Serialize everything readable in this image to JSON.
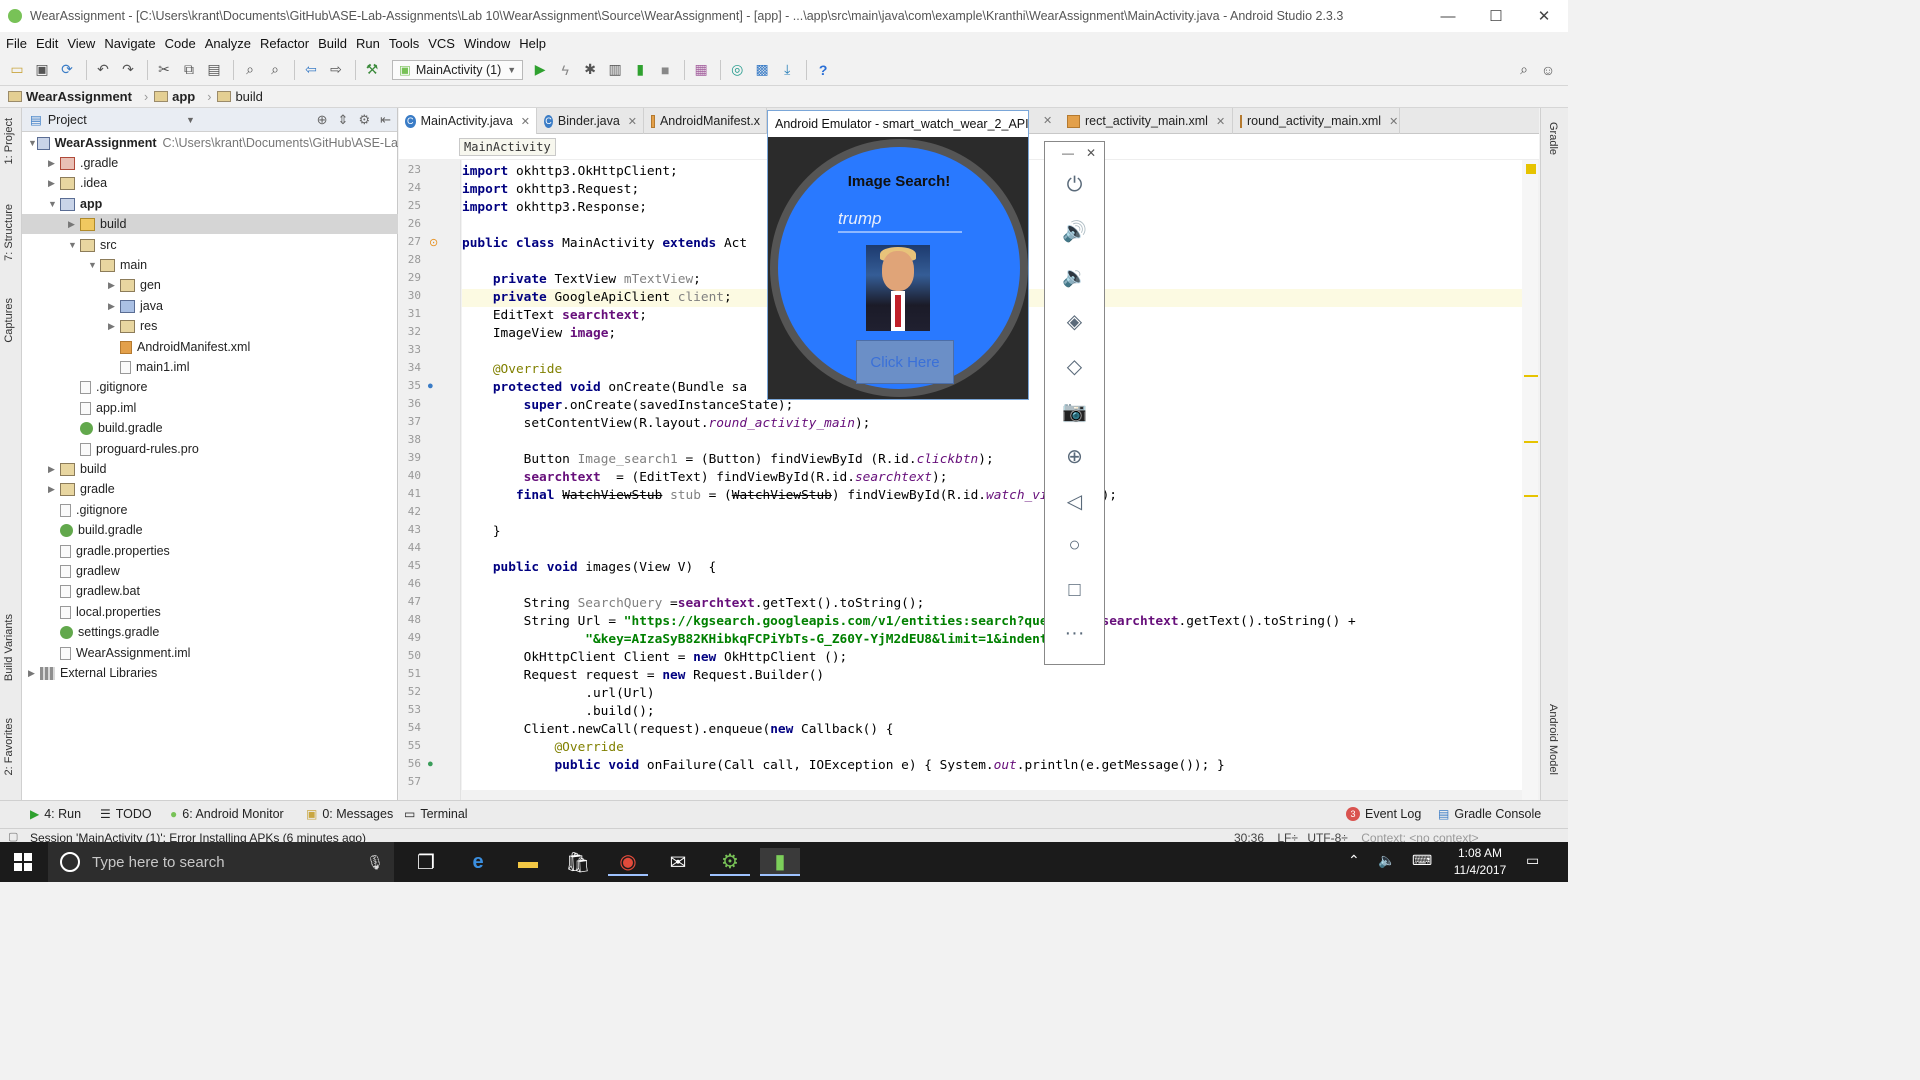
{
  "window": {
    "title": "WearAssignment - [C:\\Users\\krant\\Documents\\GitHub\\ASE-Lab-Assignments\\Lab 10\\WearAssignment\\Source\\WearAssignment] - [app] - ...\\app\\src\\main\\java\\com\\example\\Kranthi\\WearAssignment\\MainActivity.java - Android Studio 2.3.3",
    "minimize": "—",
    "maximize": "☐",
    "close": "✕"
  },
  "menu": [
    "File",
    "Edit",
    "View",
    "Navigate",
    "Code",
    "Analyze",
    "Refactor",
    "Build",
    "Run",
    "Tools",
    "VCS",
    "Window",
    "Help"
  ],
  "toolbar": {
    "run_config": "MainActivity (1)"
  },
  "nav": {
    "project": "WearAssignment",
    "module": "app",
    "folder": "build"
  },
  "side_tabs": {
    "project": "1: Project",
    "structure": "7: Structure",
    "captures": "Captures",
    "build_variants": "Build Variants",
    "favorites": "2: Favorites",
    "gradle": "Gradle",
    "android_model": "Android Model"
  },
  "project_panel": {
    "view_label": "Project",
    "tree": [
      {
        "label": "WearAssignment",
        "hint": "C:\\Users\\krant\\Documents\\GitHub\\ASE-La",
        "bold": true
      },
      {
        "label": ".gradle"
      },
      {
        "label": ".idea"
      },
      {
        "label": "app",
        "bold": true
      },
      {
        "label": "build"
      },
      {
        "label": "src"
      },
      {
        "label": "main"
      },
      {
        "label": "gen"
      },
      {
        "label": "java"
      },
      {
        "label": "res"
      },
      {
        "label": "AndroidManifest.xml"
      },
      {
        "label": "main1.iml"
      },
      {
        "label": ".gitignore"
      },
      {
        "label": "app.iml"
      },
      {
        "label": "build.gradle"
      },
      {
        "label": "proguard-rules.pro"
      },
      {
        "label": "build"
      },
      {
        "label": "gradle"
      },
      {
        "label": ".gitignore"
      },
      {
        "label": "build.gradle"
      },
      {
        "label": "gradle.properties"
      },
      {
        "label": "gradlew"
      },
      {
        "label": "gradlew.bat"
      },
      {
        "label": "local.properties"
      },
      {
        "label": "settings.gradle"
      },
      {
        "label": "WearAssignment.iml"
      },
      {
        "label": "External Libraries"
      }
    ]
  },
  "editor": {
    "tabs": [
      "MainActivity.java",
      "Binder.java",
      "AndroidManifest.x",
      "rect_activity_main.xml",
      "round_activity_main.xml"
    ],
    "breadcrumb_class": "MainActivity",
    "line_numbers": [
      "23",
      "24",
      "25",
      "26",
      "27",
      "28",
      "29",
      "30",
      "31",
      "32",
      "33",
      "34",
      "35",
      "36",
      "37",
      "38",
      "39",
      "40",
      "41",
      "42",
      "43",
      "44",
      "45",
      "46",
      "47",
      "48",
      "49",
      "50",
      "51",
      "52",
      "53",
      "54",
      "55",
      "56",
      "57"
    ]
  },
  "emulator": {
    "title": "Android Emulator - smart_watch_wear_2_API_...",
    "app_title": "Image Search!",
    "query": "trump",
    "button": "Click Here",
    "controls": [
      "power-icon",
      "volume-up-icon",
      "volume-down-icon",
      "rotate-left-icon",
      "rotate-right-icon",
      "camera-icon",
      "zoom-icon",
      "back-icon",
      "home-icon",
      "overview-icon",
      "more-icon"
    ]
  },
  "bottom_tools": {
    "run": "4: Run",
    "todo": "TODO",
    "monitor": "6: Android Monitor",
    "messages": "0: Messages",
    "terminal": "Terminal",
    "event_log": "Event Log",
    "event_count": "3",
    "gradle_console": "Gradle Console"
  },
  "status": {
    "message": "Session 'MainActivity (1)': Error Installing APKs (6 minutes ago)",
    "position": "30:36",
    "line_sep": "LF÷",
    "encoding": "UTF-8÷",
    "context": "Context: <no context>"
  },
  "taskbar": {
    "search_placeholder": "Type here to search",
    "time": "1:08 AM",
    "date": "11/4/2017"
  },
  "colors": {
    "watch_face": "#2979ff",
    "keyword": "#000080",
    "string": "#008000"
  }
}
